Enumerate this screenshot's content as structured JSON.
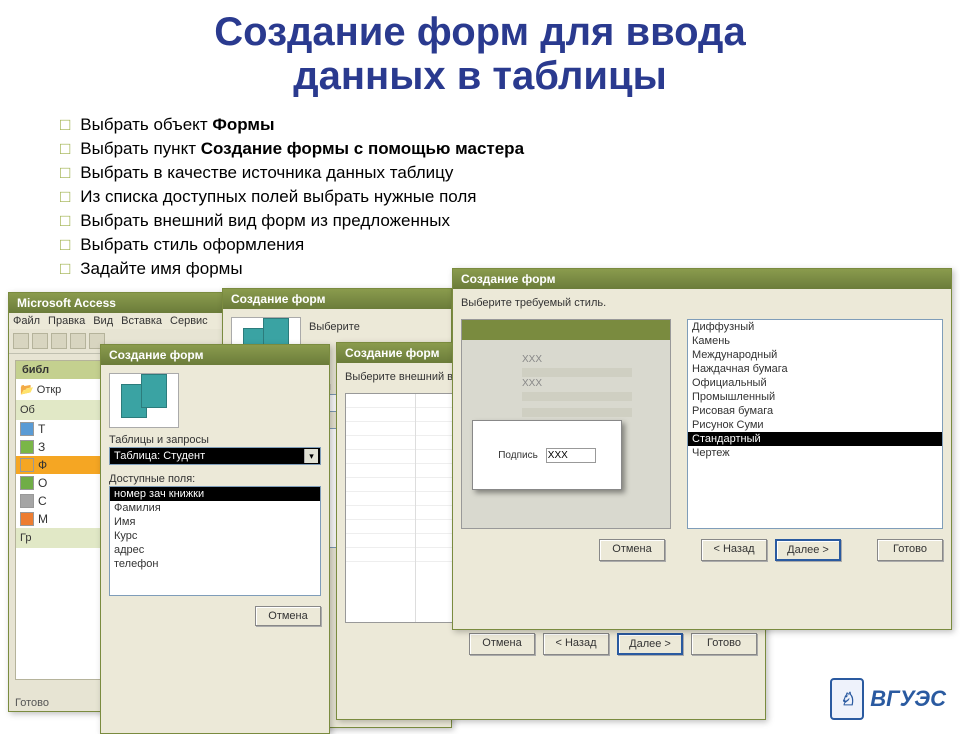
{
  "title_line1": "Создание форм для ввода",
  "title_line2": "данных в таблицы",
  "bullets": [
    {
      "pre": "Выбрать объект ",
      "bold": "Формы",
      "post": ""
    },
    {
      "pre": "Выбрать пункт ",
      "bold": "Создание формы с помощью мастера",
      "post": ""
    },
    {
      "pre": "Выбрать в качестве источника данных таблицу",
      "bold": "",
      "post": ""
    },
    {
      "pre": "Из списка доступных полей выбрать нужные поля",
      "bold": "",
      "post": ""
    },
    {
      "pre": "Выбрать внешний вид форм из предложенных",
      "bold": "",
      "post": ""
    },
    {
      "pre": "Выбрать стиль оформления",
      "bold": "",
      "post": ""
    },
    {
      "pre": "Задайте имя формы",
      "bold": "",
      "post": ""
    }
  ],
  "access": {
    "title": "Microsoft Access",
    "menu": [
      "Файл",
      "Правка",
      "Вид",
      "Вставка",
      "Сервис"
    ],
    "db_header": "библ",
    "open_btn": "Откр",
    "objects_label": "Об",
    "groups_label": "Гр",
    "status": "Готово"
  },
  "wiz1": {
    "title": "Создание форм",
    "tables_label": "Таблицы и запросы",
    "table_selected": "Таблица: Студент",
    "fields_label": "Доступные поля:",
    "fields": [
      "номер зач книжки",
      "Фамилия",
      "Имя",
      "Курс",
      "адрес",
      "телефон"
    ],
    "selected_field_index": 0,
    "btn_cancel": "Отмена"
  },
  "wiz2": {
    "title": "Создание форм",
    "prompt": "Выберите",
    "tables_label": "Таблицы и запросы",
    "table_selected": "Таблица: Студент",
    "fields_label": "Доступные поля:"
  },
  "wiz3": {
    "title": "Создание форм",
    "prompt": "Выберите внешний вид",
    "btn_cancel": "Отмена",
    "btn_back": "< Назад",
    "btn_next": "Далее >",
    "btn_finish": "Готово"
  },
  "wiz4": {
    "title": "Создание форм",
    "prompt": "Выберите требуемый стиль.",
    "styles": [
      "Диффузный",
      "Камень",
      "Международный",
      "Наждачная бумага",
      "Официальный",
      "Промышленный",
      "Рисовая бумага",
      "Рисунок Суми",
      "Стандартный",
      "Чертеж"
    ],
    "selected_style_index": 8,
    "preview_label": "Подпись",
    "preview_value": "XXX",
    "preview_xxx": "XXX",
    "btn_cancel": "Отмена",
    "btn_back": "< Назад",
    "btn_next": "Далее >",
    "btn_finish": "Готово"
  },
  "logo": {
    "text": "ВГУЭС",
    "badge": "♘"
  }
}
